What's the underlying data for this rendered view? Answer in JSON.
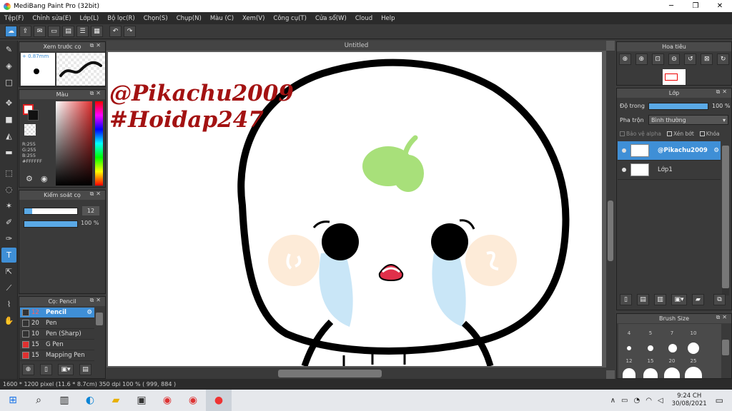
{
  "window": {
    "title": "MediBang Paint Pro (32bit)",
    "minimize": "─",
    "maximize": "❐",
    "close": "✕"
  },
  "menu": [
    "Tệp(F)",
    "Chỉnh sửa(E)",
    "Lớp(L)",
    "Bộ lọc(R)",
    "Chọn(S)",
    "Chụp(N)",
    "Màu (C)",
    "Xem(V)",
    "Công cụ(T)",
    "Cửa sổ(W)",
    "Cloud",
    "Help"
  ],
  "brush_preview": {
    "title": "Xem trước cọ",
    "size": "0.87mm"
  },
  "color_panel": {
    "title": "Màu",
    "r": "R:255",
    "g": "G:255",
    "b": "B:255",
    "hex": "#FFFFFF"
  },
  "brush_control": {
    "title": "Kiểm soát cọ",
    "size_value": "12",
    "opacity_value": "100 %",
    "size_fraction": 0.15,
    "opacity_fraction": 1.0
  },
  "brush_list": {
    "title": "Cọ: Pencil",
    "items": [
      {
        "size": "12",
        "name": "Pencil",
        "color": "#333333"
      },
      {
        "size": "20",
        "name": "Pen",
        "color": "#333333"
      },
      {
        "size": "10",
        "name": "Pen (Sharp)",
        "color": "#333333"
      },
      {
        "size": "15",
        "name": "G Pen",
        "color": "#e03030"
      },
      {
        "size": "15",
        "name": "Mapping Pen",
        "color": "#e03030"
      }
    ]
  },
  "document": {
    "tab": "Untitled",
    "text_line1": "@Pikachu2009",
    "text_line2": "#Hoidap247",
    "text_color": "#a31212"
  },
  "navigator": {
    "title": "Hoa tiêu"
  },
  "layer_panel": {
    "title": "Lớp",
    "opacity_label": "Độ trong",
    "opacity_value": "100 %",
    "opacity_fraction": 1.0,
    "blend_label": "Pha trộn",
    "blend_value": "Bình thường",
    "protect_alpha": "Bảo vệ alpha",
    "clipping": "Xén bớt",
    "lock": "Khóa",
    "layers": [
      {
        "name": "@Pikachu2009",
        "selected": true
      },
      {
        "name": "Lớp1",
        "selected": false
      }
    ]
  },
  "brush_size": {
    "title": "Brush Size",
    "sizes": [
      "4",
      "5",
      "7",
      "10",
      "12",
      "15",
      "20",
      "25"
    ]
  },
  "status": {
    "text": "1600 * 1200 pixel   (11.6 * 8.7cm)   350 dpi   100 %   ( 999, 884 )"
  },
  "taskbar": {
    "time": "9:24 CH",
    "date": "30/08/2021"
  },
  "colors": {
    "accent": "#3f8fd6",
    "sprout": "#a8e07a",
    "tears": "#c9e6f7",
    "blush": "#fdebd8"
  }
}
